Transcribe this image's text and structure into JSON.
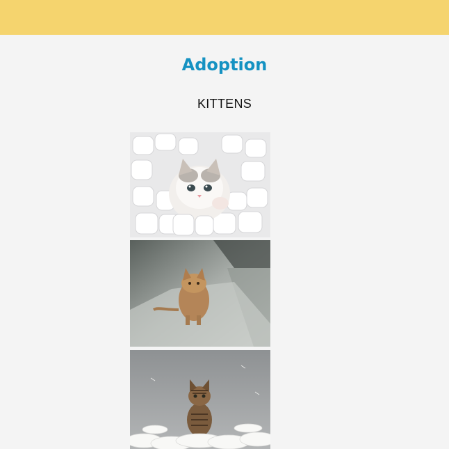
{
  "page": {
    "title": "Adoption",
    "section": "KITTENS"
  },
  "colors": {
    "topbar": "#f5d46e",
    "title": "#1592c2",
    "background": "#f4f4f4"
  },
  "photos": [
    {
      "icon": "kitten-in-marshmallows-photo"
    },
    {
      "icon": "wet-kitten-photo"
    },
    {
      "icon": "tabby-kitten-in-feathers-photo"
    }
  ]
}
